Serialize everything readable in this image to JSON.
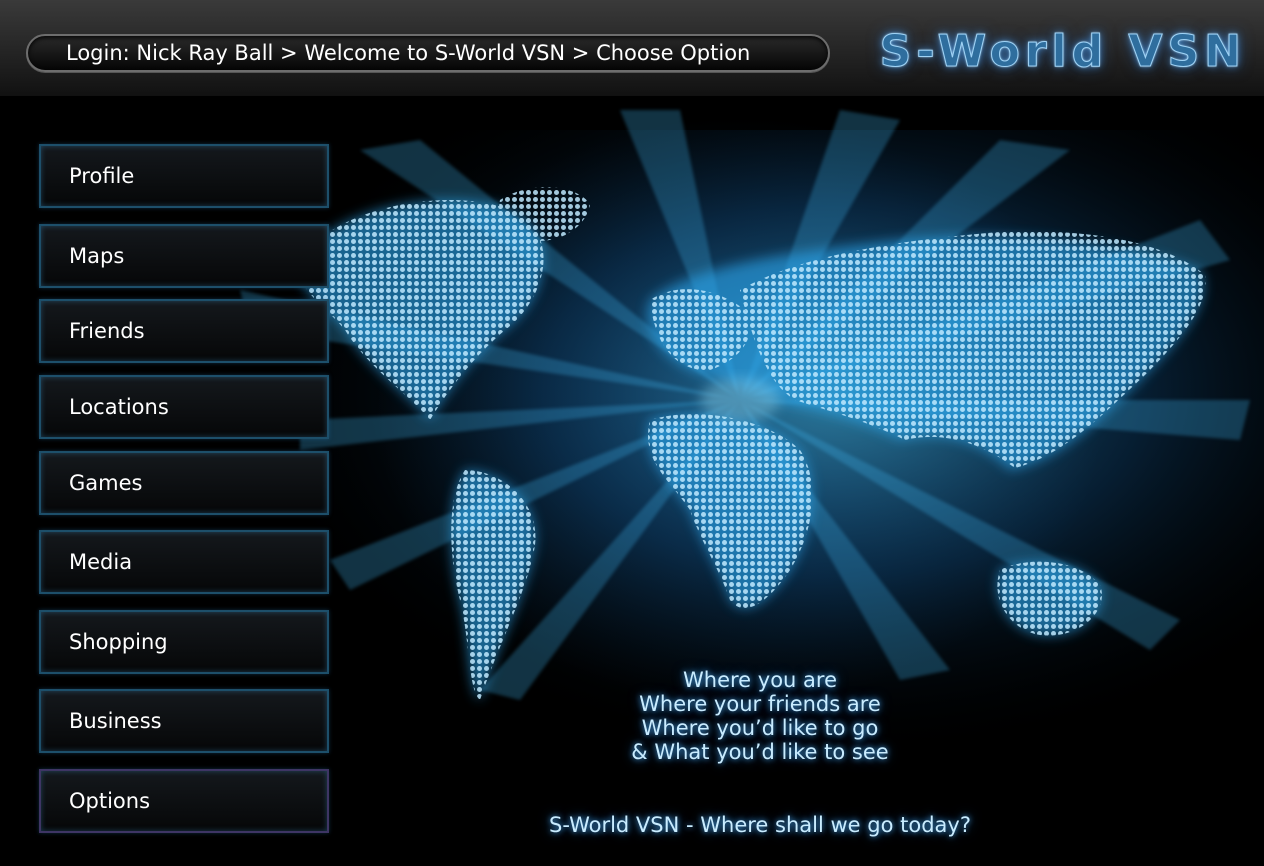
{
  "header": {
    "breadcrumb": "Login: Nick Ray Ball > Welcome to S-World VSN > Choose Option",
    "logo": "S-World VSN"
  },
  "menu": {
    "items": [
      {
        "label": "Profile"
      },
      {
        "label": "Maps"
      },
      {
        "label": "Friends"
      },
      {
        "label": "Locations"
      },
      {
        "label": "Games"
      },
      {
        "label": "Media"
      },
      {
        "label": "Shopping"
      },
      {
        "label": "Business"
      },
      {
        "label": "Options"
      }
    ]
  },
  "tagline": {
    "lines": [
      "Where you are",
      "Where your friends are",
      "Where you’d like to go",
      "& What you’d like to see"
    ],
    "slogan": "S-World VSN - Where shall we go today?"
  },
  "colors": {
    "background": "#000000",
    "accent": "#46b4f0",
    "button_border": "#1d4f6a",
    "text": "#ffffff"
  }
}
